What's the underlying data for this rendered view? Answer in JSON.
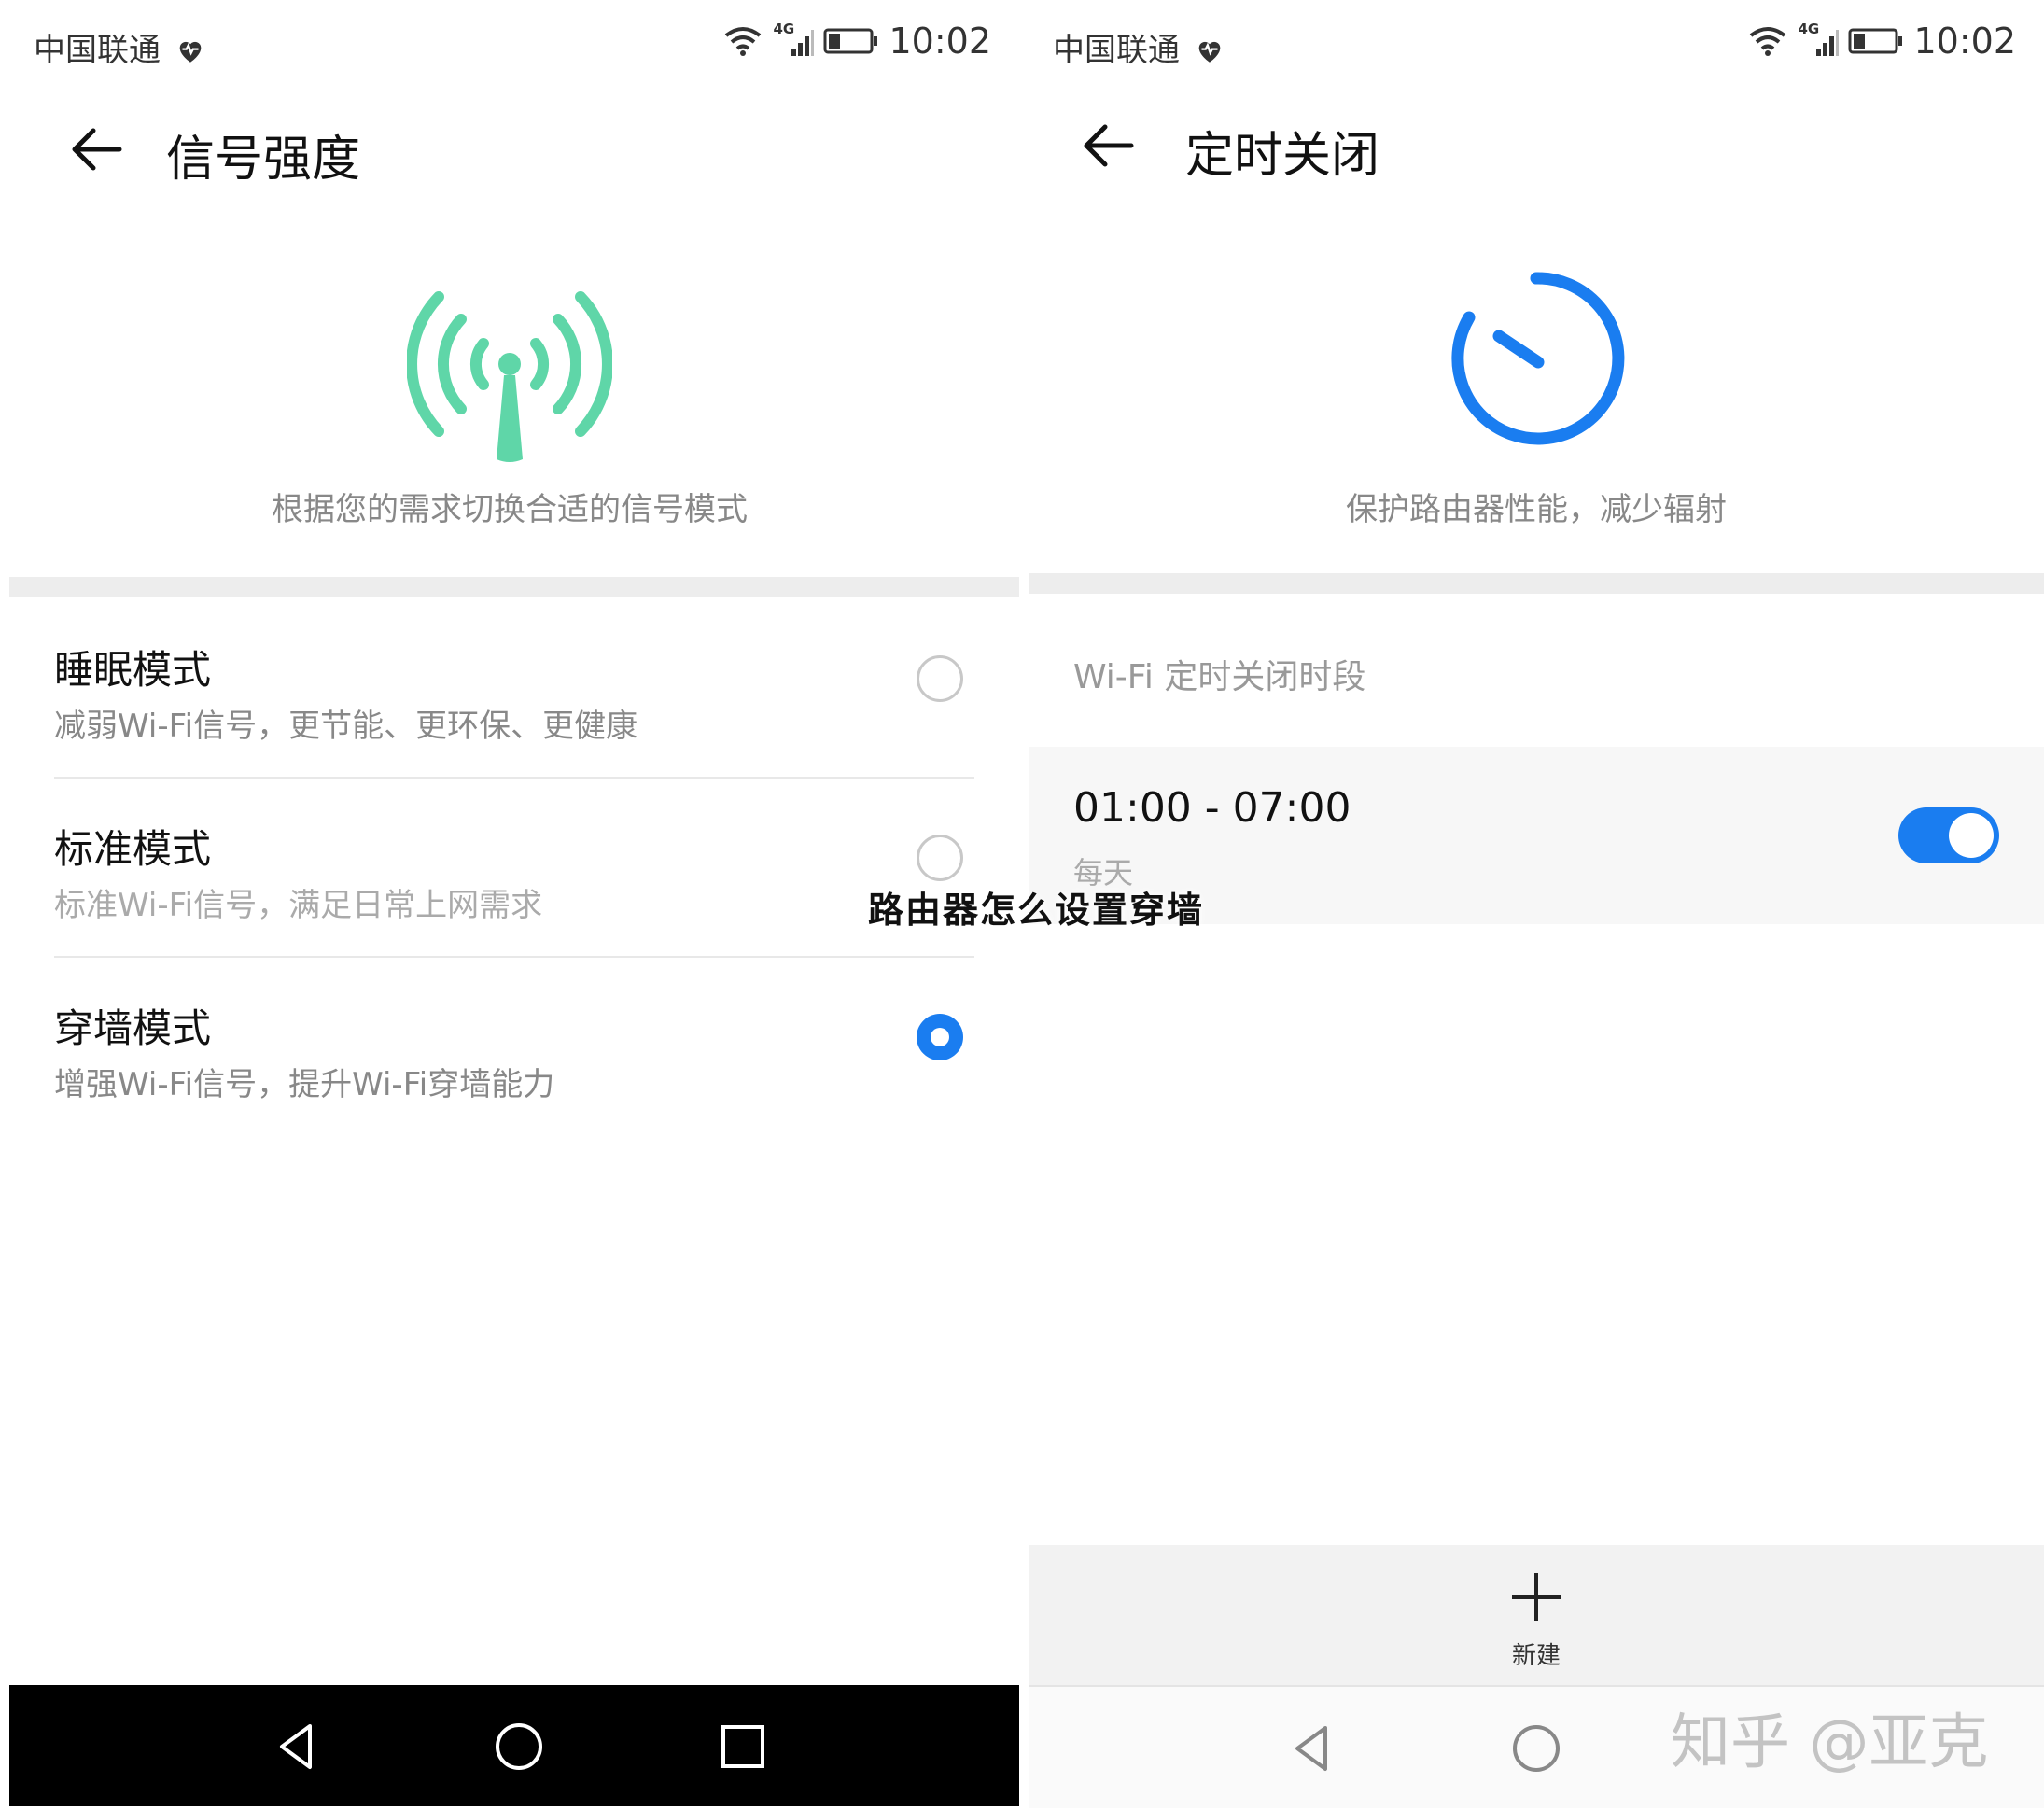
{
  "status_bar": {
    "carrier": "中国联通",
    "network": "4G",
    "time": "10:02"
  },
  "left_screen": {
    "title": "信号强度",
    "hero_text": "根据您的需求切换合适的信号模式",
    "icon_color": "#5fd6a8",
    "modes": [
      {
        "name": "睡眠模式",
        "desc": "减弱Wi-Fi信号，更节能、更环保、更健康",
        "selected": false
      },
      {
        "name": "标准模式",
        "desc": "标准Wi-Fi信号，满足日常上网需求",
        "selected": false
      },
      {
        "name": "穿墙模式",
        "desc": "增强Wi-Fi信号，提升Wi-Fi穿墙能力",
        "selected": true
      }
    ]
  },
  "right_screen": {
    "title": "定时关闭",
    "hero_text": "保护路由器性能，减少辐射",
    "icon_color": "#1a7df0",
    "section_label": "Wi-Fi 定时关闭时段",
    "schedule": {
      "time_range": "01:00 - 07:00",
      "repeat": "每天",
      "enabled": true
    },
    "new_label": "新建"
  },
  "overlay_caption": "路由器怎么设置穿墙",
  "watermark": "知乎 @亚克",
  "accent_color": "#1a7df0"
}
